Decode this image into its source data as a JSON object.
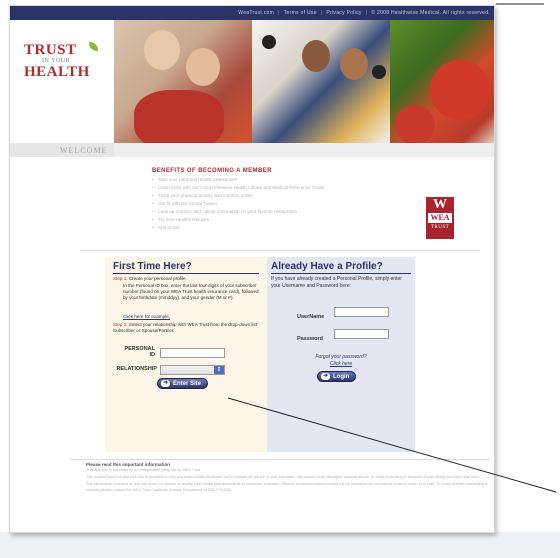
{
  "topnav": {
    "items": [
      "WeaTrust.com",
      "Terms of Use",
      "Privacy Policy",
      "© 2008 Healthwise Medical. All rights reserved."
    ]
  },
  "logo": {
    "line1": "TRUST",
    "line2": "IN YOUR",
    "line3": "HEALTH"
  },
  "welcome": "WELCOME",
  "benefits": {
    "title": "BENEFITS OF BECOMING A MEMBER",
    "items": [
      "Take your personal Health Assessment",
      "Learn more with our Comprehensive Health Library and Medical Reference Guide",
      "Track your physical activity and nutrition online",
      "Get fit with our Virtual Trainer",
      "Look up nutrition and calorie information on your favorite restaurants",
      "Try new Healthy Recipes",
      "And more!"
    ]
  },
  "wea_logo": {
    "w": "W",
    "name": "WEA",
    "sub": "TRUST"
  },
  "first_time": {
    "title": "First Time Here?",
    "step1_label": "Step 1:",
    "step1_text": "Create your personal profile.",
    "step1_detail": "In the Personal ID box, enter the last four digits of your subscriber number (found on your WEA Trust health insurance card), followed by your birthdate (mmddyy), and your gender (M or F).",
    "step1_link": "Click here for example.",
    "step2_label": "Step 2:",
    "step2_text": "Select your relationship with WEA Trust from the drop-down list: Subscriber or Spouse/Partner.",
    "personal_id_label_1": "PERSONAL",
    "personal_id_label_2": "ID",
    "relationship_label": "RELATIONSHIP",
    "relationship_value": "",
    "button": "Enter Site"
  },
  "profile": {
    "title": "Already Have a Profile?",
    "intro": "If you have already created a Personal Profile, simply enter your Username and Password here:",
    "username_label": "UserName",
    "password_label": "Password",
    "forgot_text": "Forgot your password?",
    "forgot_link": "Click here",
    "button": "Login"
  },
  "footer": {
    "title": "Please read this important information",
    "p1": "This web site is operated by an independent party not by WEA Trust.",
    "p2": "The content found on this web site is provided to help you make health decisions, not to replace the advice of your physician. You should never disregard medical advice, or delay in seeking it, because of something you have read here.",
    "p3": "The information provided on this site does not replace or modify your health plan documents or insurance coverage. Medical recommendations should not be construed as necessarily covered under your plan. To verify whether something is covered please contact the WEA Trust Customer Service Department at 800-279-4000."
  }
}
